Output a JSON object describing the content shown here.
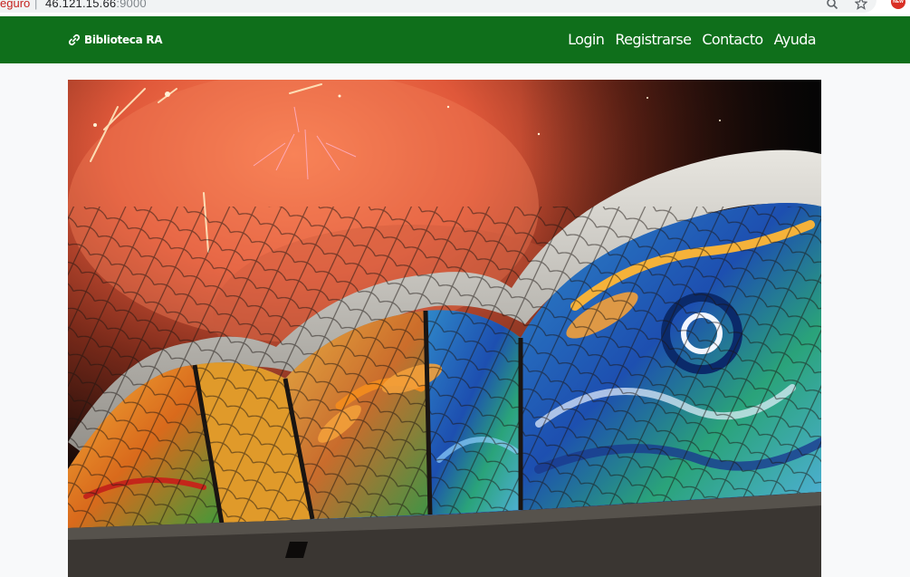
{
  "browser": {
    "security_label": "eguro",
    "separator": "|",
    "url_host": "46.121.15.66",
    "url_port": ":9000",
    "zoom_icon": "search-icon",
    "bookmark_icon": "star-icon",
    "extension_icon": "extension-badge-icon"
  },
  "navbar": {
    "brand_icon": "link-icon",
    "brand_label": "Biblioteca RA",
    "links": [
      {
        "label": "Login"
      },
      {
        "label": "Registrarse"
      },
      {
        "label": "Contacto"
      },
      {
        "label": "Ayuda"
      }
    ],
    "background_color": "#0f6f1b"
  },
  "hero": {
    "image_description_icon": "stained-glass-fireworks-photo"
  }
}
